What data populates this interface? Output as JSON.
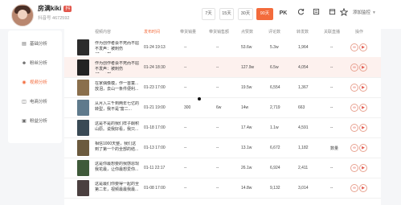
{
  "account": {
    "name": "房满kiki",
    "badge": "抖",
    "id_text": "抖音号 4672592"
  },
  "ranges": [
    "7天",
    "15天",
    "30天",
    "90天"
  ],
  "active_range": "90天",
  "header_icons": {
    "pk": "PK",
    "refresh": "refresh-icon",
    "add_monitor": "添加监控"
  },
  "sidebar": {
    "items": [
      {
        "label": "基础分析",
        "icon": "chart-icon"
      },
      {
        "label": "粉丝分析",
        "icon": "fans-icon"
      },
      {
        "label": "视频分析",
        "icon": "video-icon"
      },
      {
        "label": "电商分析",
        "icon": "cart-icon"
      },
      {
        "label": "粉益分析",
        "icon": "profit-icon"
      }
    ]
  },
  "table": {
    "headers": [
      "视频内容",
      "发布时间",
      "带货销量",
      "带货销售额",
      "点赞数",
      "评论数",
      "转发数",
      "关联直播",
      "操作"
    ],
    "rows": [
      {
        "title": "作为创作者会不死而不屈不发声：被刺伤47cm+到...",
        "date": "01-24 19:13",
        "sales": "--",
        "revenue": "--",
        "likes": "53.6w",
        "comments": "5.3w",
        "shares": "1,964",
        "live": "--",
        "thumb": "#2c2c2c"
      },
      {
        "title": "作为创作者会不死而不屈不发声：被刺伤47cm+到...",
        "date": "01-24 18:30",
        "sales": "--",
        "revenue": "--",
        "likes": "127.9w",
        "comments": "6.5w",
        "shares": "4,054",
        "live": "--",
        "thumb": "#232323"
      },
      {
        "title": "在家偶像模，作一首童...放泪，去山一条件便利...",
        "date": "01-23 17:00",
        "sales": "--",
        "revenue": "--",
        "likes": "19.5w",
        "comments": "6,554",
        "shares": "1,367",
        "live": "--",
        "thumb": "#8a6f4c"
      },
      {
        "title": "从月入三千到两年七亿的转型，我不是“富二...",
        "date": "01-21 19:00",
        "sales": "300",
        "revenue": "6w",
        "likes": "14w",
        "comments": "2,719",
        "shares": "663",
        "live": "--",
        "thumb": "#5f7a8c"
      },
      {
        "title": "这是不是的我们样子酮积山原。说我好看，我只...",
        "date": "01-18 17:00",
        "sales": "--",
        "revenue": "--",
        "likes": "17.4w",
        "comments": "1.1w",
        "shares": "4,591",
        "live": "--",
        "thumb": "#3a4a55"
      },
      {
        "title": "相信1000天整，我们这到了第一个的全部的结...",
        "date": "01-13 17:00",
        "sales": "--",
        "revenue": "--",
        "likes": "13.1w",
        "comments": "6,672",
        "shares": "1,182",
        "live": "数量",
        "thumb": "#6b5a3e"
      },
      {
        "title": "这是你最想要的我感恩现我花最，让你最想爱你...",
        "date": "01-11 22:17",
        "sales": "--",
        "revenue": "--",
        "likes": "26.1w",
        "comments": "6,924",
        "shares": "2,411",
        "live": "--",
        "thumb": "#3f5a3a"
      },
      {
        "title": "这是最们你要得一起的全第二年，视频最最我最...",
        "date": "01-08 17:00",
        "sales": "--",
        "revenue": "--",
        "likes": "14.8w",
        "comments": "9,132",
        "shares": "3,014",
        "live": "--",
        "thumb": "#4b4040"
      }
    ]
  }
}
